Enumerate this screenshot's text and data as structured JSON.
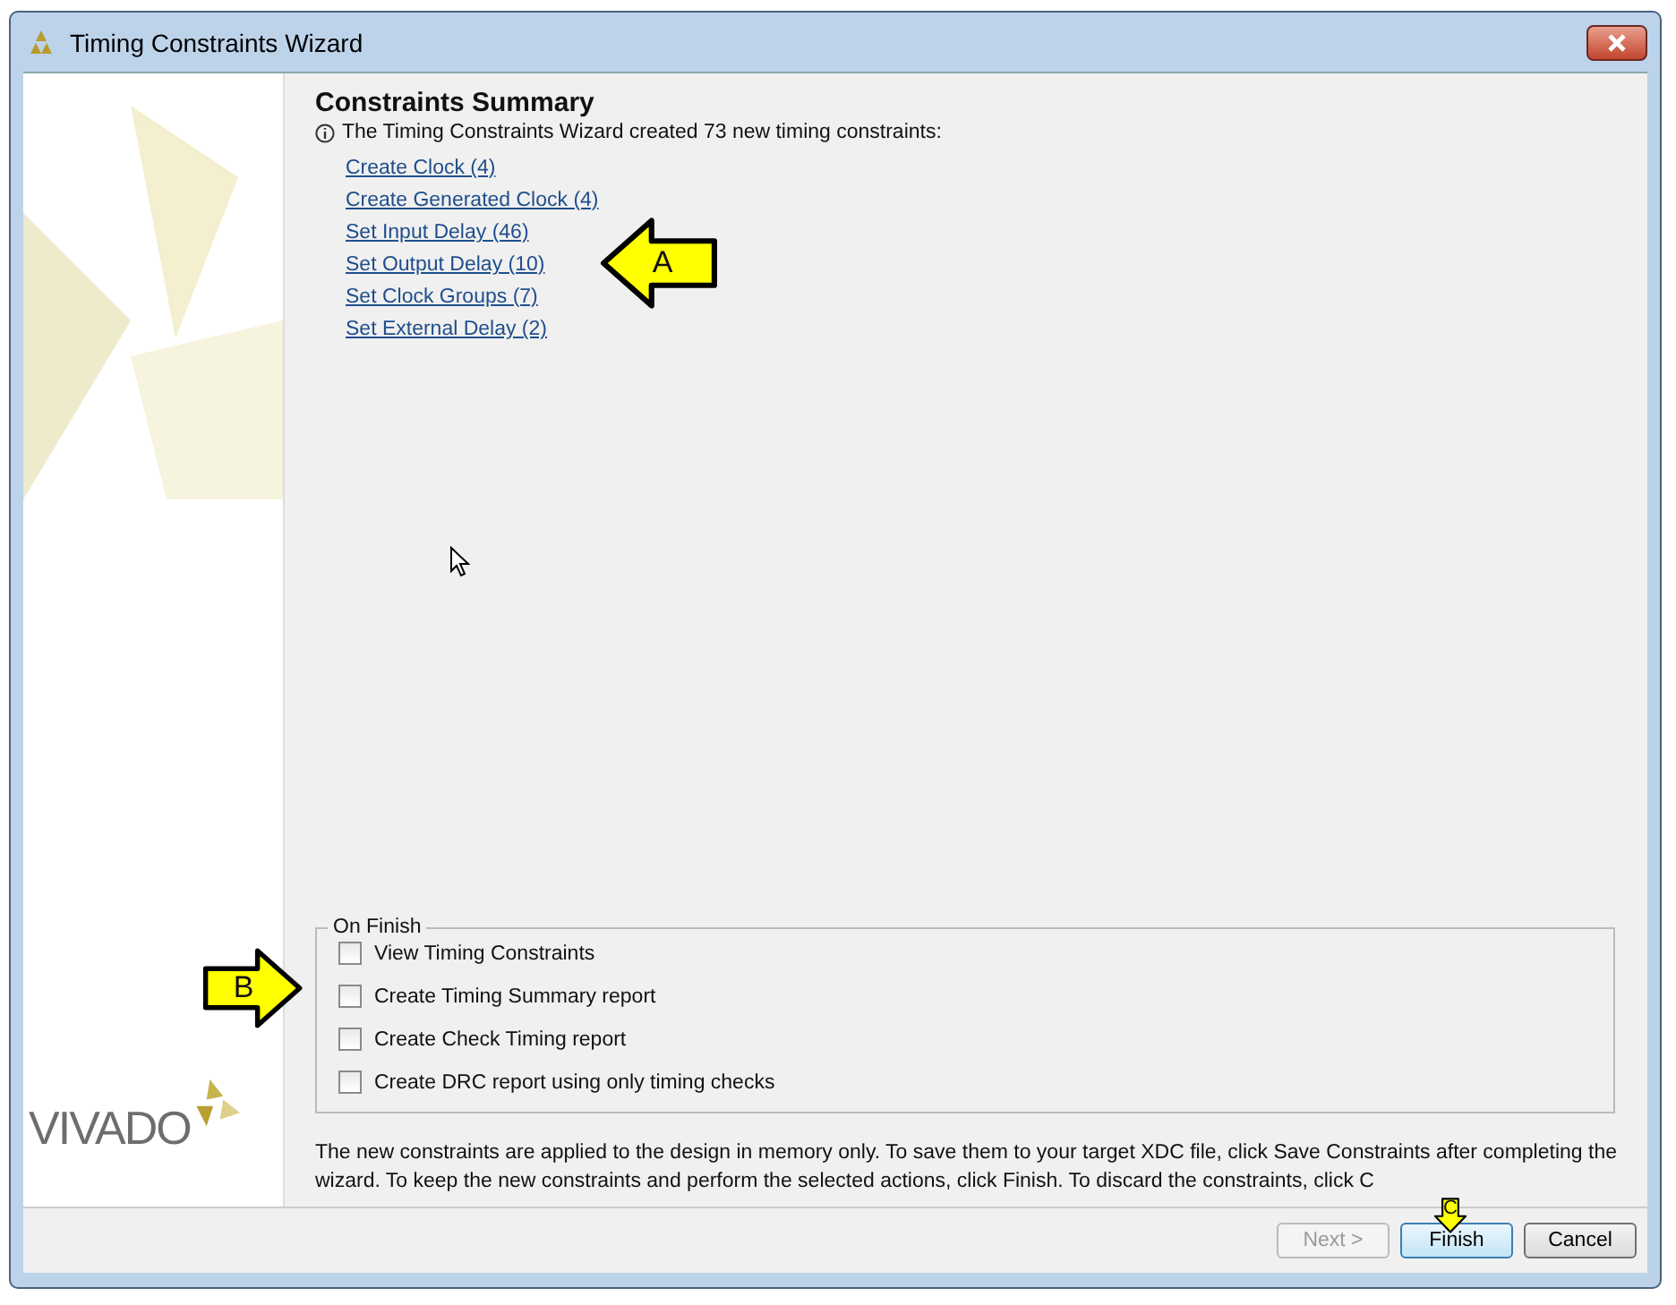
{
  "window": {
    "title": "Timing Constraints Wizard"
  },
  "logo": {
    "text": "VIVADO"
  },
  "summary": {
    "title": "Constraints Summary",
    "info": "The Timing Constraints Wizard created 73 new timing constraints:",
    "links": [
      "Create Clock (4)",
      "Create Generated Clock (4)",
      "Set Input Delay (46)",
      "Set Output Delay (10)",
      "Set Clock Groups (7)",
      "Set External Delay (2)"
    ]
  },
  "on_finish": {
    "legend": "On Finish",
    "options": [
      {
        "label": "View Timing Constraints",
        "checked": false
      },
      {
        "label": "Create Timing Summary report",
        "checked": false
      },
      {
        "label": "Create Check Timing report",
        "checked": false
      },
      {
        "label": "Create DRC report using only timing checks",
        "checked": false
      }
    ]
  },
  "note": "The new constraints are applied to the design in memory only. To save them to your target XDC file, click Save Constraints after completing the wizard. To keep the new constraints and perform the selected actions, click Finish. To discard the constraints, click C",
  "buttons": [
    {
      "label": "Next >",
      "disabled": true,
      "default": false
    },
    {
      "label": "Finish",
      "disabled": false,
      "default": true
    },
    {
      "label": "Cancel",
      "disabled": false,
      "default": false
    }
  ],
  "callouts": [
    {
      "label": "A",
      "kind": "left"
    },
    {
      "label": "B",
      "kind": "right"
    },
    {
      "label": "C",
      "kind": "down"
    }
  ]
}
